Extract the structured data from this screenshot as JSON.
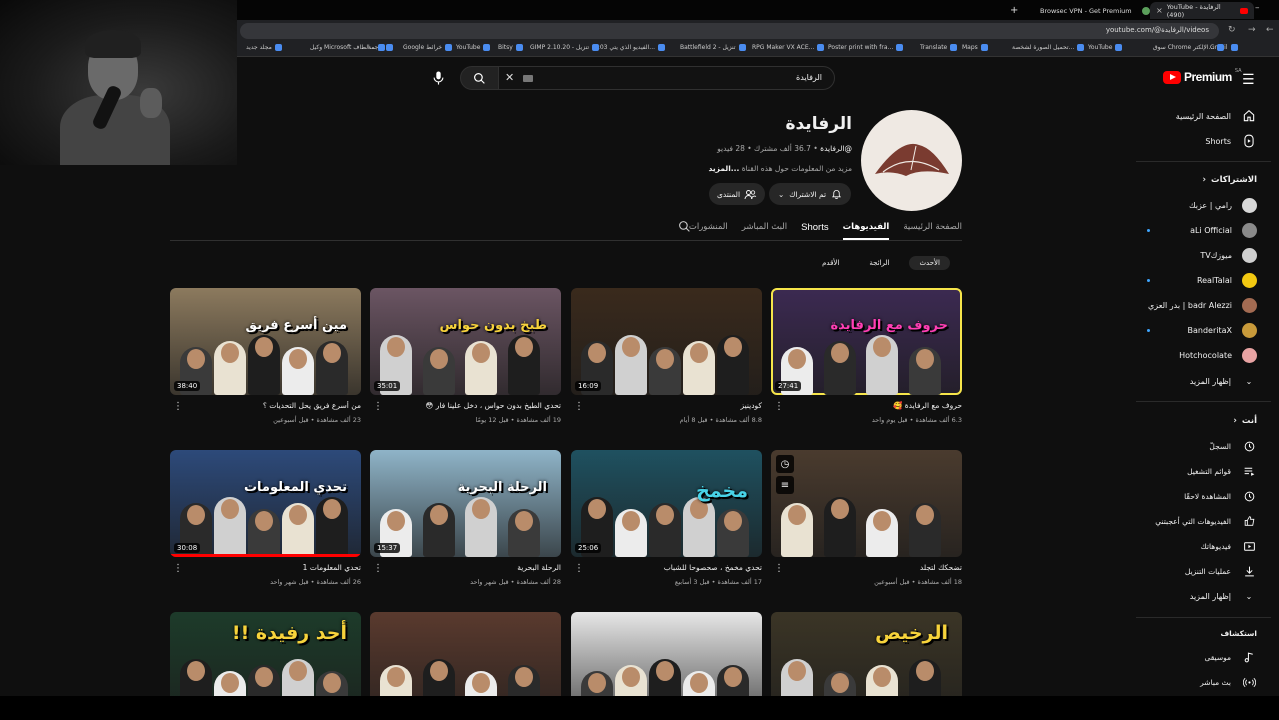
{
  "browser": {
    "tabs": [
      {
        "title": "YouTube - الرفايدة (490)",
        "active": true
      },
      {
        "title": "Browsec VPN - Get Premium",
        "active": false
      }
    ],
    "new_tab": "+",
    "url": "youtube.com/@الرفايدة/videos",
    "bookmarks": [
      "Gmail",
      "سوق Chrome الإلكتر...",
      "YouTube",
      "تحميل الصورة لشخصة...",
      "Maps",
      "Translate",
      "Poster print with fra...",
      "RPG Maker VX ACE...",
      "Battlefield 2 - تنزيل",
      "2:03 الفيديو الذي يتي...",
      "GIMP 2.10.20 - تنزيل",
      "Bitsy",
      "YouTube",
      "Google خرائط",
      "ترجمة",
      "وكيل Microsoft الطاف...",
      "مجلد جديد"
    ]
  },
  "masthead": {
    "logo_text": "Premium",
    "logo_region": "SA",
    "search_value": "الرفايدة"
  },
  "sidebar": {
    "main": [
      {
        "label": "الصفحة الرئيسية",
        "icon": "home-icon"
      },
      {
        "label": "Shorts",
        "icon": "shorts-icon"
      }
    ],
    "subs_header": "الاشتراكات",
    "subscriptions": [
      {
        "label": "رامي | عزبك",
        "color": "#d7d7d7",
        "dot": false
      },
      {
        "label": "aLi Official",
        "color": "#8a8a8a",
        "dot": true
      },
      {
        "label": "ميوزكTV",
        "color": "#cfcfcf",
        "dot": false
      },
      {
        "label": "RealTalal",
        "color": "#f2c811",
        "dot": true
      },
      {
        "label": "badr Alezzi | بدر العزي",
        "color": "#a36b52",
        "dot": false
      },
      {
        "label": "BanderitaX",
        "color": "#c89a3a",
        "dot": true
      },
      {
        "label": "Hotchocolate",
        "color": "#e8a3a3",
        "dot": false
      }
    ],
    "subs_more": "إظهار المزيد",
    "you_header": "أنت",
    "you": [
      {
        "label": "السجلّ",
        "icon": "history-icon"
      },
      {
        "label": "قوائم التشغيل",
        "icon": "playlists-icon"
      },
      {
        "label": "المشاهدة لاحقًا",
        "icon": "watch-later-icon"
      },
      {
        "label": "الفيديوهات التي أعجبتني",
        "icon": "like-icon"
      },
      {
        "label": "فيديوهاتك",
        "icon": "your-videos-icon"
      },
      {
        "label": "عمليات التنزيل",
        "icon": "download-icon"
      }
    ],
    "you_more": "إظهار المزيد",
    "explore_header": "استكشاف",
    "explore": [
      {
        "label": "موسيقى",
        "icon": "music-icon"
      },
      {
        "label": "بث مباشر",
        "icon": "live-icon"
      }
    ]
  },
  "channel": {
    "name": "الرفايدة",
    "handle": "@الرفايدة",
    "meta_rest": " • 36.7 ألف مشترك • 28 فيديو",
    "desc": "مزيد من المعلومات حول هذه القناة",
    "desc_more": "...المزيد",
    "subscribed_label": "تم الاشتراك",
    "join_label": "المنتدى"
  },
  "tabs": [
    "الصفحة الرئيسية",
    "الفيديوهات",
    "Shorts",
    "البث المباشر",
    "المنشورات"
  ],
  "active_tab": "الفيديوهات",
  "chips": [
    "الأحدث",
    "الرائجة",
    "الأقدم"
  ],
  "videos": [
    {
      "title": "حروف مع الرفايدة 🥰",
      "meta": "6.3 ألف مشاهدة • قبل يوم واحد",
      "duration": "27:41",
      "bg": "#3c2a52",
      "overlay": "حروف مع الرفايدة",
      "overlay_color": "#ff3fb5",
      "selected": true
    },
    {
      "title": "كودينيز",
      "meta": "8.8 ألف مشاهدة • قبل 8 أيام",
      "duration": "16:09",
      "bg": "#3a2a1c",
      "overlay": "",
      "overlay_color": "#fff",
      "selected": false
    },
    {
      "title": "تحدي الطبخ بدون حواس ، دخل علينا فار 😳",
      "meta": "19 ألف مشاهدة • قبل 12 يومًا",
      "duration": "35:01",
      "bg": "#6b5563",
      "overlay": "طبخ بدون حواس",
      "overlay_color": "#f7d33b",
      "selected": false
    },
    {
      "title": "من أسرع فريق يحل التحديات ؟",
      "meta": "23 ألف مشاهدة • قبل أسبوعين",
      "duration": "38:40",
      "bg": "#8c7a5e",
      "overlay": "مين أسرع فريق",
      "overlay_color": "#ffffff",
      "selected": false
    },
    {
      "title": "تضحكك لتجلد",
      "meta": "18 ألف مشاهدة • قبل أسبوعين",
      "duration": "",
      "bg": "#4a3b2e",
      "overlay": "",
      "overlay_color": "#fff",
      "selected": false
    },
    {
      "title": "تحدي مخمخ ، صحصوحا للشباب",
      "meta": "17 ألف مشاهدة • قبل 3 أسابيع",
      "duration": "25:06",
      "bg": "#1f5160",
      "overlay": "مخمخ",
      "overlay_color": "#48d3e8",
      "selected": false
    },
    {
      "title": "الرحلة البحرية",
      "meta": "28 ألف مشاهدة • قبل شهر واحد",
      "duration": "15:37",
      "bg": "#8fb4c8",
      "overlay": "الرحلة البحرية",
      "overlay_color": "#ffffff",
      "selected": false
    },
    {
      "title": "تحدي المعلومات 1",
      "meta": "26 ألف مشاهدة • قبل شهر واحد",
      "duration": "30:08",
      "bg": "#2d4a7a",
      "overlay": "تحدي المعلومات",
      "overlay_color": "#ffffff",
      "selected": false
    },
    {
      "title": "",
      "meta": "",
      "duration": "",
      "bg": "#3b3526",
      "overlay": "الرخيص",
      "overlay_color": "#f7d33b",
      "selected": false
    },
    {
      "title": "",
      "meta": "",
      "duration": "",
      "bg": "#e7e7e7",
      "overlay": "",
      "overlay_color": "#fff",
      "selected": false
    },
    {
      "title": "",
      "meta": "",
      "duration": "",
      "bg": "#5a3a2e",
      "overlay": "",
      "overlay_color": "#fff",
      "selected": false
    },
    {
      "title": "",
      "meta": "",
      "duration": "",
      "bg": "#1d3b2a",
      "overlay": "أحد رفيدة !!",
      "overlay_color": "#f7d33b",
      "selected": false
    }
  ]
}
